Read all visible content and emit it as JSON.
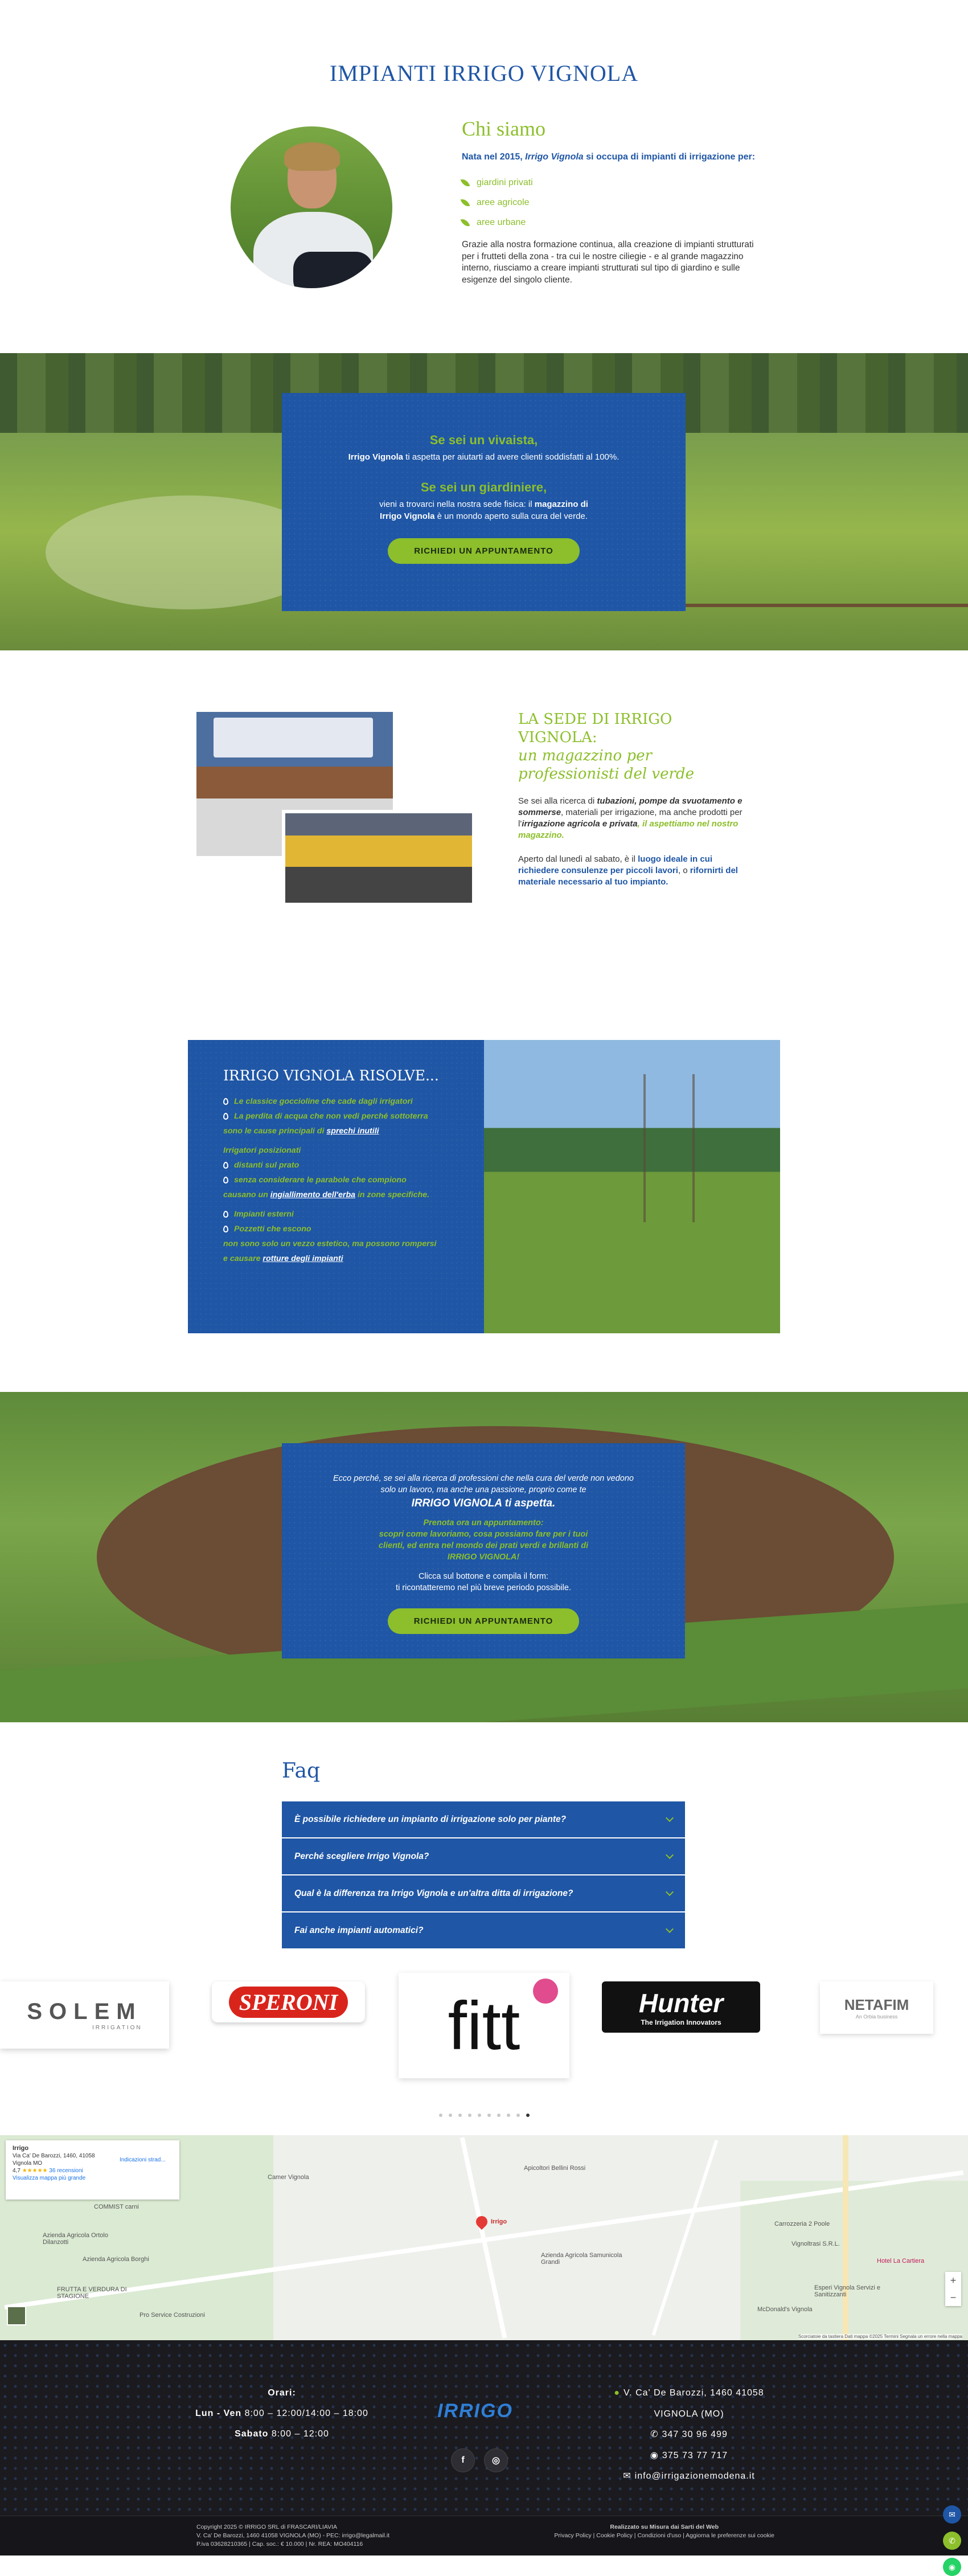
{
  "hero": {
    "title": "IMPIANTI IRRIGO VIGNOLA",
    "about_title": "Chi siamo",
    "intro_pre": "Nata nel 2015, ",
    "intro_brand": "Irrigo Vignola",
    "intro_post": " si occupa di impianti di irrigazione per:",
    "items": [
      "giardini privati",
      "aree agricole",
      "aree urbane"
    ],
    "body": "Grazie alla nostra formazione continua, alla creazione di impianti strutturati per i frutteti della zona - tra cui le nostre ciliegie - e al grande magazzino interno, riusciamo a creare impianti strutturati sul tipo di giardino e sulle esigenze del singolo cliente."
  },
  "vivaista": {
    "h1": "Se sei un vivaista,",
    "p1_brand": "Irrigo Vignola",
    "p1_rest": " ti aspetta per aiutarti ad avere clienti soddisfatti al 100%.",
    "h2": "Se sei un giardiniere,",
    "p2_pre": "vieni a trovarci nella nostra sede fisica: il ",
    "p2_bold": "magazzino di Irrigo Vignola",
    "p2_post": " è un mondo aperto sulla cura del verde.",
    "button": "RICHIEDI UN APPUNTAMENTO"
  },
  "sede": {
    "title_line1": "LA SEDE DI IRRIGO VIGNOLA:",
    "title_line2": "un magazzino per professionisti del verde",
    "p1_a": "Se sei alla ricerca di ",
    "p1_b": "tubazioni, pompe da svuotamento e sommerse",
    "p1_c": ", materiali per irrigazione, ma anche prodotti per l'",
    "p1_d": "irrigazione agricola e privata",
    "p1_e": ", il aspettiamo nel nostro magazzino.",
    "p2_a": "Aperto dal lunedì al sabato, è il ",
    "p2_b": "luogo ideale in cui richiedere consulenze per piccoli lavori",
    "p2_c": ", o ",
    "p2_d": "rifornirti del materiale necessario al tuo impianto."
  },
  "risolve": {
    "title": "IRRIGO VIGNOLA RISOLVE...",
    "r1": "Le classice goccioline che cade dagli irrigatori",
    "r2": "La perdita di acqua che non vedi perché sottoterra",
    "r3a": "sono le cause principali di ",
    "r3b": "sprechi inutili",
    "r4": "Irrigatori posizionati",
    "r5": "distanti sul prato",
    "r6": "senza considerare le parabole che compiono",
    "r7a": "causano un ",
    "r7b": "ingiallimento dell'erba",
    "r7c": " in zone specifiche.",
    "r8": "Impianti esterni",
    "r9": "Pozzetti che escono",
    "r10": "non sono solo un vezzo estetico, ma possono rompersi",
    "r11a": "e causare ",
    "r11b": "rotture degli impianti"
  },
  "contact": {
    "p1": "Ecco perché, se sei alla ricerca di professioni che nella cura del verde non vedono solo un lavoro, ma anche una passione, proprio come te",
    "p1_strong": "IRRIGO VIGNOLA ti aspetta.",
    "p2a": "Prenota ora un appuntamento:",
    "p2b": "scopri come lavoriamo, cosa possiamo fare per i tuoi clienti, ed entra nel mondo dei prati verdi e brillanti di IRRIGO VIGNOLA!",
    "p3a": "Clicca sul bottone e compila il form:",
    "p3b": "ti ricontatteremo nel più breve periodo possibile.",
    "button": "RICHIEDI UN APPUNTAMENTO"
  },
  "faq": {
    "title": "Faq",
    "items": [
      "È possibile richiedere un impianto di irrigazione solo per piante?",
      "Perché scegliere Irrigo Vignola?",
      "Qual è la differenza tra Irrigo Vignola e un'altra ditta di irrigazione?",
      "Fai anche impianti automatici?"
    ]
  },
  "logos": {
    "solem": "SOLEM",
    "solem_sub": "IRRIGATION",
    "speroni": "SPERONI",
    "fitt": "fitt",
    "hunter": "Hunter",
    "hunter_sub": "The Irrigation Innovators",
    "netafim": "NETAFIM",
    "netafim_sub": "An Orbia business"
  },
  "map": {
    "name": "Irrigo",
    "address": "Via Ca' De Barozzi, 1460, 41058 Vignola MO",
    "rating": "4,7",
    "reviews": "36 recensioni",
    "directions": "Indicazioni strad...",
    "bigger": "Visualizza mappa più grande",
    "places": [
      "COMMIST carni",
      "Azienda Agricola Ortolo Dilanzotti",
      "Azienda Agricola Borghi",
      "FRUTTA E VERDURA DI STAGIONE",
      "Pro Service Costruzioni",
      "Camer Vignola",
      "Apicoltori Bellini Rossi",
      "Azienda Agricola Samunicola Grandi",
      "Carrozzeria 2 Poole",
      "Vignoltrasi S.R.L.",
      "Hotel La Cartiera",
      "Esperi Vignola Servizi e Sanitizzanti",
      "McDonald's Vignola"
    ],
    "attribution": "Scorciatoie da tastiera   Dati mappa ©2025   Termini   Segnala un errore nella mappa"
  },
  "footer": {
    "orari": "Orari:",
    "line1_a": "Lun - Ven",
    "line1_b": " 8:00 – 12:00/14:00 – 18:00",
    "line2_a": "Sabato",
    "line2_b": " 8:00 – 12:00",
    "logo": "IRRIGO",
    "address": "V. Ca' De Barozzi, 1460 41058",
    "city": "VIGNOLA (MO)",
    "phone1": "347 30 96 499",
    "phone2": "375 73 77 717",
    "email": "info@irrigazionemodena.it",
    "copy1": "Copyright 2025 © IRRIGO SRL di FRASCARI/LIAVIA",
    "copy2": "V. Ca' De Barozzi, 1460 41058 VIGNOLA (MO) - PEC: irrigo@legalmail.it",
    "copy3": "P.iva 03628210365 | Cap. soc.: € 10.000 | Nr. REA: MO404116",
    "made": "Realizzato su Misura dai Sarti del Web",
    "links": "Privacy Policy | Cookie Policy | Condizioni d'uso | Aggiorna le preferenze sui cookie"
  },
  "colors": {
    "brand_blue": "#1f56a5",
    "brand_green": "#8cbf2b"
  },
  "icons": [
    "leaf-icon",
    "drop-icon",
    "chevron-down-icon",
    "facebook-icon",
    "instagram-icon",
    "map-pin-icon",
    "phone-icon",
    "whatsapp-icon",
    "mail-icon"
  ]
}
